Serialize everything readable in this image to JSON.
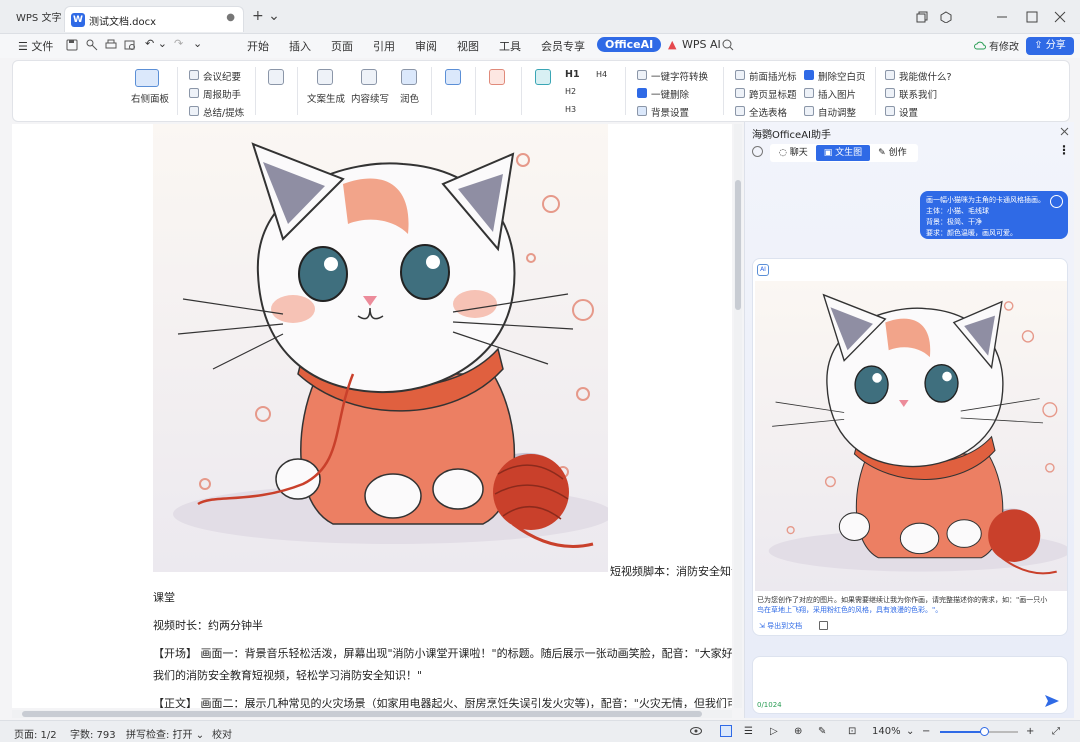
{
  "titlebar": {
    "app_tab": "WPS 文字",
    "doc_tab": "测试文档.docx",
    "doc_icon": "W",
    "close": "●",
    "plus": "+ ⌄"
  },
  "menubar": {
    "file": "☰ 文件",
    "items": [
      "开始",
      "插入",
      "页面",
      "引用",
      "审阅",
      "视图",
      "工具",
      "会员专享"
    ],
    "active": "OfficeAI",
    "wps_ai": "WPS AI",
    "modify": "有修改",
    "share": "分享"
  },
  "ribbon": {
    "right_panel": "右侧面板",
    "meeting": "会议纪要",
    "weekly": "周报助手",
    "summary": "总结/提炼",
    "copywrite": "文案生成",
    "continue": "内容续写",
    "polish": "润色",
    "h1": "H1",
    "h2": "H2",
    "h3": "H3",
    "h4": "H4",
    "one_key_convert": "一键字符转换",
    "one_key_delete": "一键删除",
    "bg_settings": "背景设置",
    "front_cursor": "前面插光标",
    "cross_page_title": "跨页显标题",
    "select_table": "全选表格",
    "delete_blank": "删除空白页",
    "insert_image": "插入图片",
    "auto_adjust": "自动调整",
    "what_can_i_do": "我能做什么?",
    "contact_us": "联系我们",
    "settings": "设置"
  },
  "document": {
    "side_caption": "短视频脚本：消防安全知识",
    "line1": "课堂",
    "line2": "视频时长：约两分钟半",
    "line3": "【开场】 画面一：背景音乐轻松活泼，屏幕出现\"消防小课堂开课啦！\"的标题。随后展示一张动画笑脸，配音：\"大家好，欢迎来",
    "line4": "我们的消防安全教育短视频，轻松学习消防安全知识！\"",
    "line5": "【正文】 画面二：展示几种常见的火灾场景（如家用电器起火、厨房烹饪失误引发火灾等)，配音：\"火灾无情，但我们可以预防"
  },
  "ai_panel": {
    "title": "海鹦OfficeAI助手",
    "seg_chat": "聊天",
    "seg_image": "文生图",
    "seg_create": "创作",
    "user_msg_1": "画一幅小猫咪为主角的卡通风格插画。",
    "user_msg_2": "主体：小猫、毛线球",
    "user_msg_3": "背景：极简、干净",
    "user_msg_4": "要求：颜色温暖，画风可爱。",
    "ai_icon": "AI",
    "response_1": "已为您创作了对应的图片。如果需要继续让我为你作画，请完整描述你的需求，如：\"画一只小",
    "response_2": "鸟在草地上飞翔，采用粉红色的风格，具有浪漫的色彩。\"。",
    "export": "导出到文档",
    "char_count": "0/1024"
  },
  "statusbar": {
    "page": "页面: 1/2",
    "words": "字数: 793",
    "spell": "拼写检查: 打开 ⌄",
    "proof": "校对",
    "zoom": "140%",
    "zoom_slider_level": 0.56
  },
  "colors": {
    "accent": "#2f6ae6",
    "cat_sweater": "#e8735a",
    "cat_eye": "#4f8fa0",
    "yarn": "#c9402b"
  }
}
